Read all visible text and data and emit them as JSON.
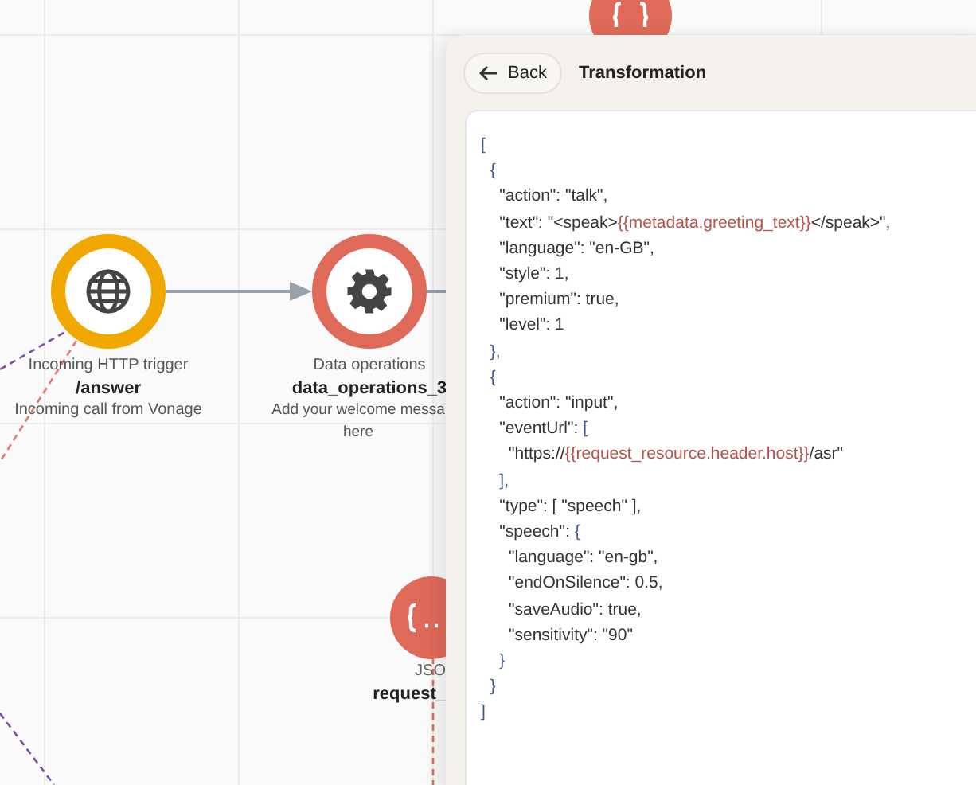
{
  "canvas": {
    "nodes": [
      {
        "kind": "trigger",
        "color": "#f0a800",
        "type_label": "Incoming HTTP trigger",
        "name": "/answer",
        "description": "Incoming call from Vonage"
      },
      {
        "kind": "operation",
        "color": "#e06a5a",
        "type_label": "Data operations",
        "name": "data_operations_3",
        "description": "Add your welcome messa\nhere"
      },
      {
        "kind": "json",
        "color": "#e06a5a",
        "type_label": "JSO",
        "name": "request_"
      },
      {
        "kind": "json",
        "color": "#e06a5a"
      }
    ]
  },
  "panel": {
    "back_button": "Back",
    "title": "Transformation",
    "code_lines": [
      [
        {
          "text": "[",
          "kind": "punct"
        }
      ],
      [
        {
          "text": "  {",
          "kind": "punct"
        }
      ],
      [
        {
          "text": "    \"action\": \"talk\",",
          "kind": "plain"
        }
      ],
      [
        {
          "text": "    \"text\": \"<speak>",
          "kind": "plain"
        },
        {
          "text": "{{metadata.greeting_text}}",
          "kind": "template"
        },
        {
          "text": "</speak>\",",
          "kind": "plain"
        }
      ],
      [
        {
          "text": "    \"language\": \"en-GB\",",
          "kind": "plain"
        }
      ],
      [
        {
          "text": "    \"style\": 1,",
          "kind": "plain"
        }
      ],
      [
        {
          "text": "    \"premium\": true,",
          "kind": "plain"
        }
      ],
      [
        {
          "text": "    \"level\": 1",
          "kind": "plain"
        }
      ],
      [
        {
          "text": "  },",
          "kind": "punct"
        }
      ],
      [
        {
          "text": "  {",
          "kind": "punct"
        }
      ],
      [
        {
          "text": "    \"action\": \"input\",",
          "kind": "plain"
        }
      ],
      [
        {
          "text": "    \"eventUrl\": ",
          "kind": "plain"
        },
        {
          "text": "[",
          "kind": "punct"
        }
      ],
      [
        {
          "text": "      \"https://",
          "kind": "plain"
        },
        {
          "text": "{{request_resource.header.host}}",
          "kind": "template"
        },
        {
          "text": "/asr\"",
          "kind": "plain"
        }
      ],
      [
        {
          "text": "    ],",
          "kind": "punct"
        }
      ],
      [
        {
          "text": "    \"type\": [ \"speech\" ],",
          "kind": "plain"
        }
      ],
      [
        {
          "text": "    \"speech\": ",
          "kind": "plain"
        },
        {
          "text": "{",
          "kind": "punct"
        }
      ],
      [
        {
          "text": "      \"language\": \"en-gb\",",
          "kind": "plain"
        }
      ],
      [
        {
          "text": "      \"endOnSilence\": 0.5,",
          "kind": "plain"
        }
      ],
      [
        {
          "text": "      \"saveAudio\": true,",
          "kind": "plain"
        }
      ],
      [
        {
          "text": "      \"sensitivity\": \"90\"",
          "kind": "plain"
        }
      ],
      [
        {
          "text": "    }",
          "kind": "punct"
        }
      ],
      [
        {
          "text": "  }",
          "kind": "punct"
        }
      ],
      [
        {
          "text": "]",
          "kind": "punct"
        }
      ]
    ]
  }
}
